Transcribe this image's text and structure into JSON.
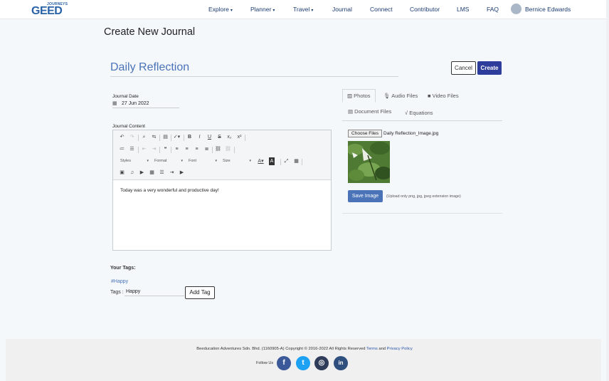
{
  "brand": {
    "small": "JOURNEYS",
    "big": "GEED"
  },
  "nav": [
    {
      "label": "Explore",
      "caret": true
    },
    {
      "label": "Planner",
      "caret": true
    },
    {
      "label": "Travel",
      "caret": true
    },
    {
      "label": "Journal",
      "caret": false
    },
    {
      "label": "Connect",
      "caret": false
    },
    {
      "label": "Contributor",
      "caret": false
    },
    {
      "label": "LMS",
      "caret": false
    },
    {
      "label": "FAQ",
      "caret": false
    }
  ],
  "user": {
    "name": "Bernice Edwards"
  },
  "page_title": "Create New Journal",
  "journal": {
    "title": "Daily Reflection",
    "cancel_label": "Cancel",
    "create_label": "Create",
    "date_label": "Journal Date",
    "date_value": "27 Jun 2022",
    "content_label": "Journal Content",
    "content_text": "Today was a very wonderful and productive day!"
  },
  "editor": {
    "combos": [
      "Styles",
      "Format",
      "Font",
      "Size"
    ]
  },
  "media_tabs": {
    "photos": "Photos",
    "audio": "Audio Files",
    "video": "Video Files",
    "documents": "Document Files",
    "equations": "Equations"
  },
  "upload": {
    "choose_label": "Choose Files",
    "file_name": "Daily Reflection_Image.jpg",
    "save_label": "Save Image",
    "hint": "(Upload only png, jpg, jpeg extension image)"
  },
  "tags": {
    "heading": "Your Tags:",
    "items": [
      "#Happy"
    ],
    "input_label": "Tags :",
    "input_value": "Happy",
    "add_label": "Add Tag"
  },
  "footer": {
    "copyright": "Beeducation Adventures Sdn. Bhd. (1160905-A) Copyright © 2016-2022 All Rights Reserved",
    "terms": "Terms",
    "and": "and",
    "privacy": "Privacy Policy",
    "follow": "Follow Us",
    "social": [
      {
        "name": "facebook",
        "glyph": "f",
        "color": "#3b5998"
      },
      {
        "name": "twitter",
        "glyph": "t",
        "color": "#1da1f2"
      },
      {
        "name": "instagram",
        "glyph": "◎",
        "color": "#2f3c5a"
      },
      {
        "name": "linkedin",
        "glyph": "in",
        "color": "#2f4f7f"
      }
    ]
  }
}
